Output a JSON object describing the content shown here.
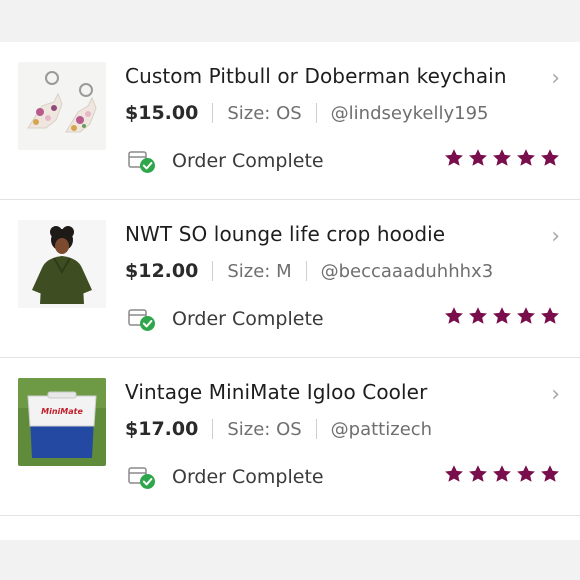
{
  "colors": {
    "star": "#7a0e4c",
    "check": "#2ea64b",
    "divider": "#e3e3e3"
  },
  "orders": [
    {
      "title": "Custom Pitbull or Doberman keychain",
      "price": "$15.00",
      "size": "Size: OS",
      "seller": "@lindseykelly195",
      "status": "Order Complete",
      "rating": 5,
      "thumb_icon": "keychain-photo"
    },
    {
      "title": "NWT SO lounge life crop hoodie",
      "price": "$12.00",
      "size": "Size: M",
      "seller": "@beccaaaduhhhx3",
      "status": "Order Complete",
      "rating": 5,
      "thumb_icon": "hoodie-photo"
    },
    {
      "title": "Vintage MiniMate Igloo Cooler",
      "price": "$17.00",
      "size": "Size: OS",
      "seller": "@pattizech",
      "status": "Order Complete",
      "rating": 5,
      "thumb_icon": "cooler-photo",
      "thumb_brand_text": "MiniMate"
    }
  ]
}
